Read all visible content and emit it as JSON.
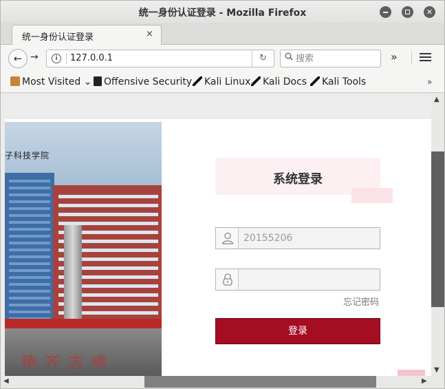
{
  "window": {
    "title": "统一身份认证登录 - Mozilla Firefox"
  },
  "tabs": [
    {
      "label": "统一身份认证登录",
      "close": "×"
    }
  ],
  "new_tab": "+",
  "nav": {
    "back": "←",
    "forward": "→",
    "info": "i",
    "url": "127.0.0.1",
    "reload": "↻",
    "search_icon": "🔍",
    "search_placeholder": "搜索",
    "overflow": "»"
  },
  "bookmarks": [
    {
      "label": "Most Visited",
      "icon": "folder-icon"
    },
    {
      "label": "Offensive Security",
      "icon": "offsec-icon"
    },
    {
      "label": "Kali Linux",
      "icon": "kali-dragon-icon"
    },
    {
      "label": "Kali Docs",
      "icon": "kali-dragon-icon"
    },
    {
      "label": "Kali Tools",
      "icon": "kali-dragon-icon"
    }
  ],
  "bookmarks_more": "»",
  "page": {
    "school_name": "子科技学院",
    "login_title": "系统登录",
    "username_value": "20155206",
    "password_value": "",
    "forgot_label": "忘记密码",
    "login_button": "登录"
  },
  "colors": {
    "accent": "#a50d23",
    "title_bg": "#fdf0f2"
  }
}
